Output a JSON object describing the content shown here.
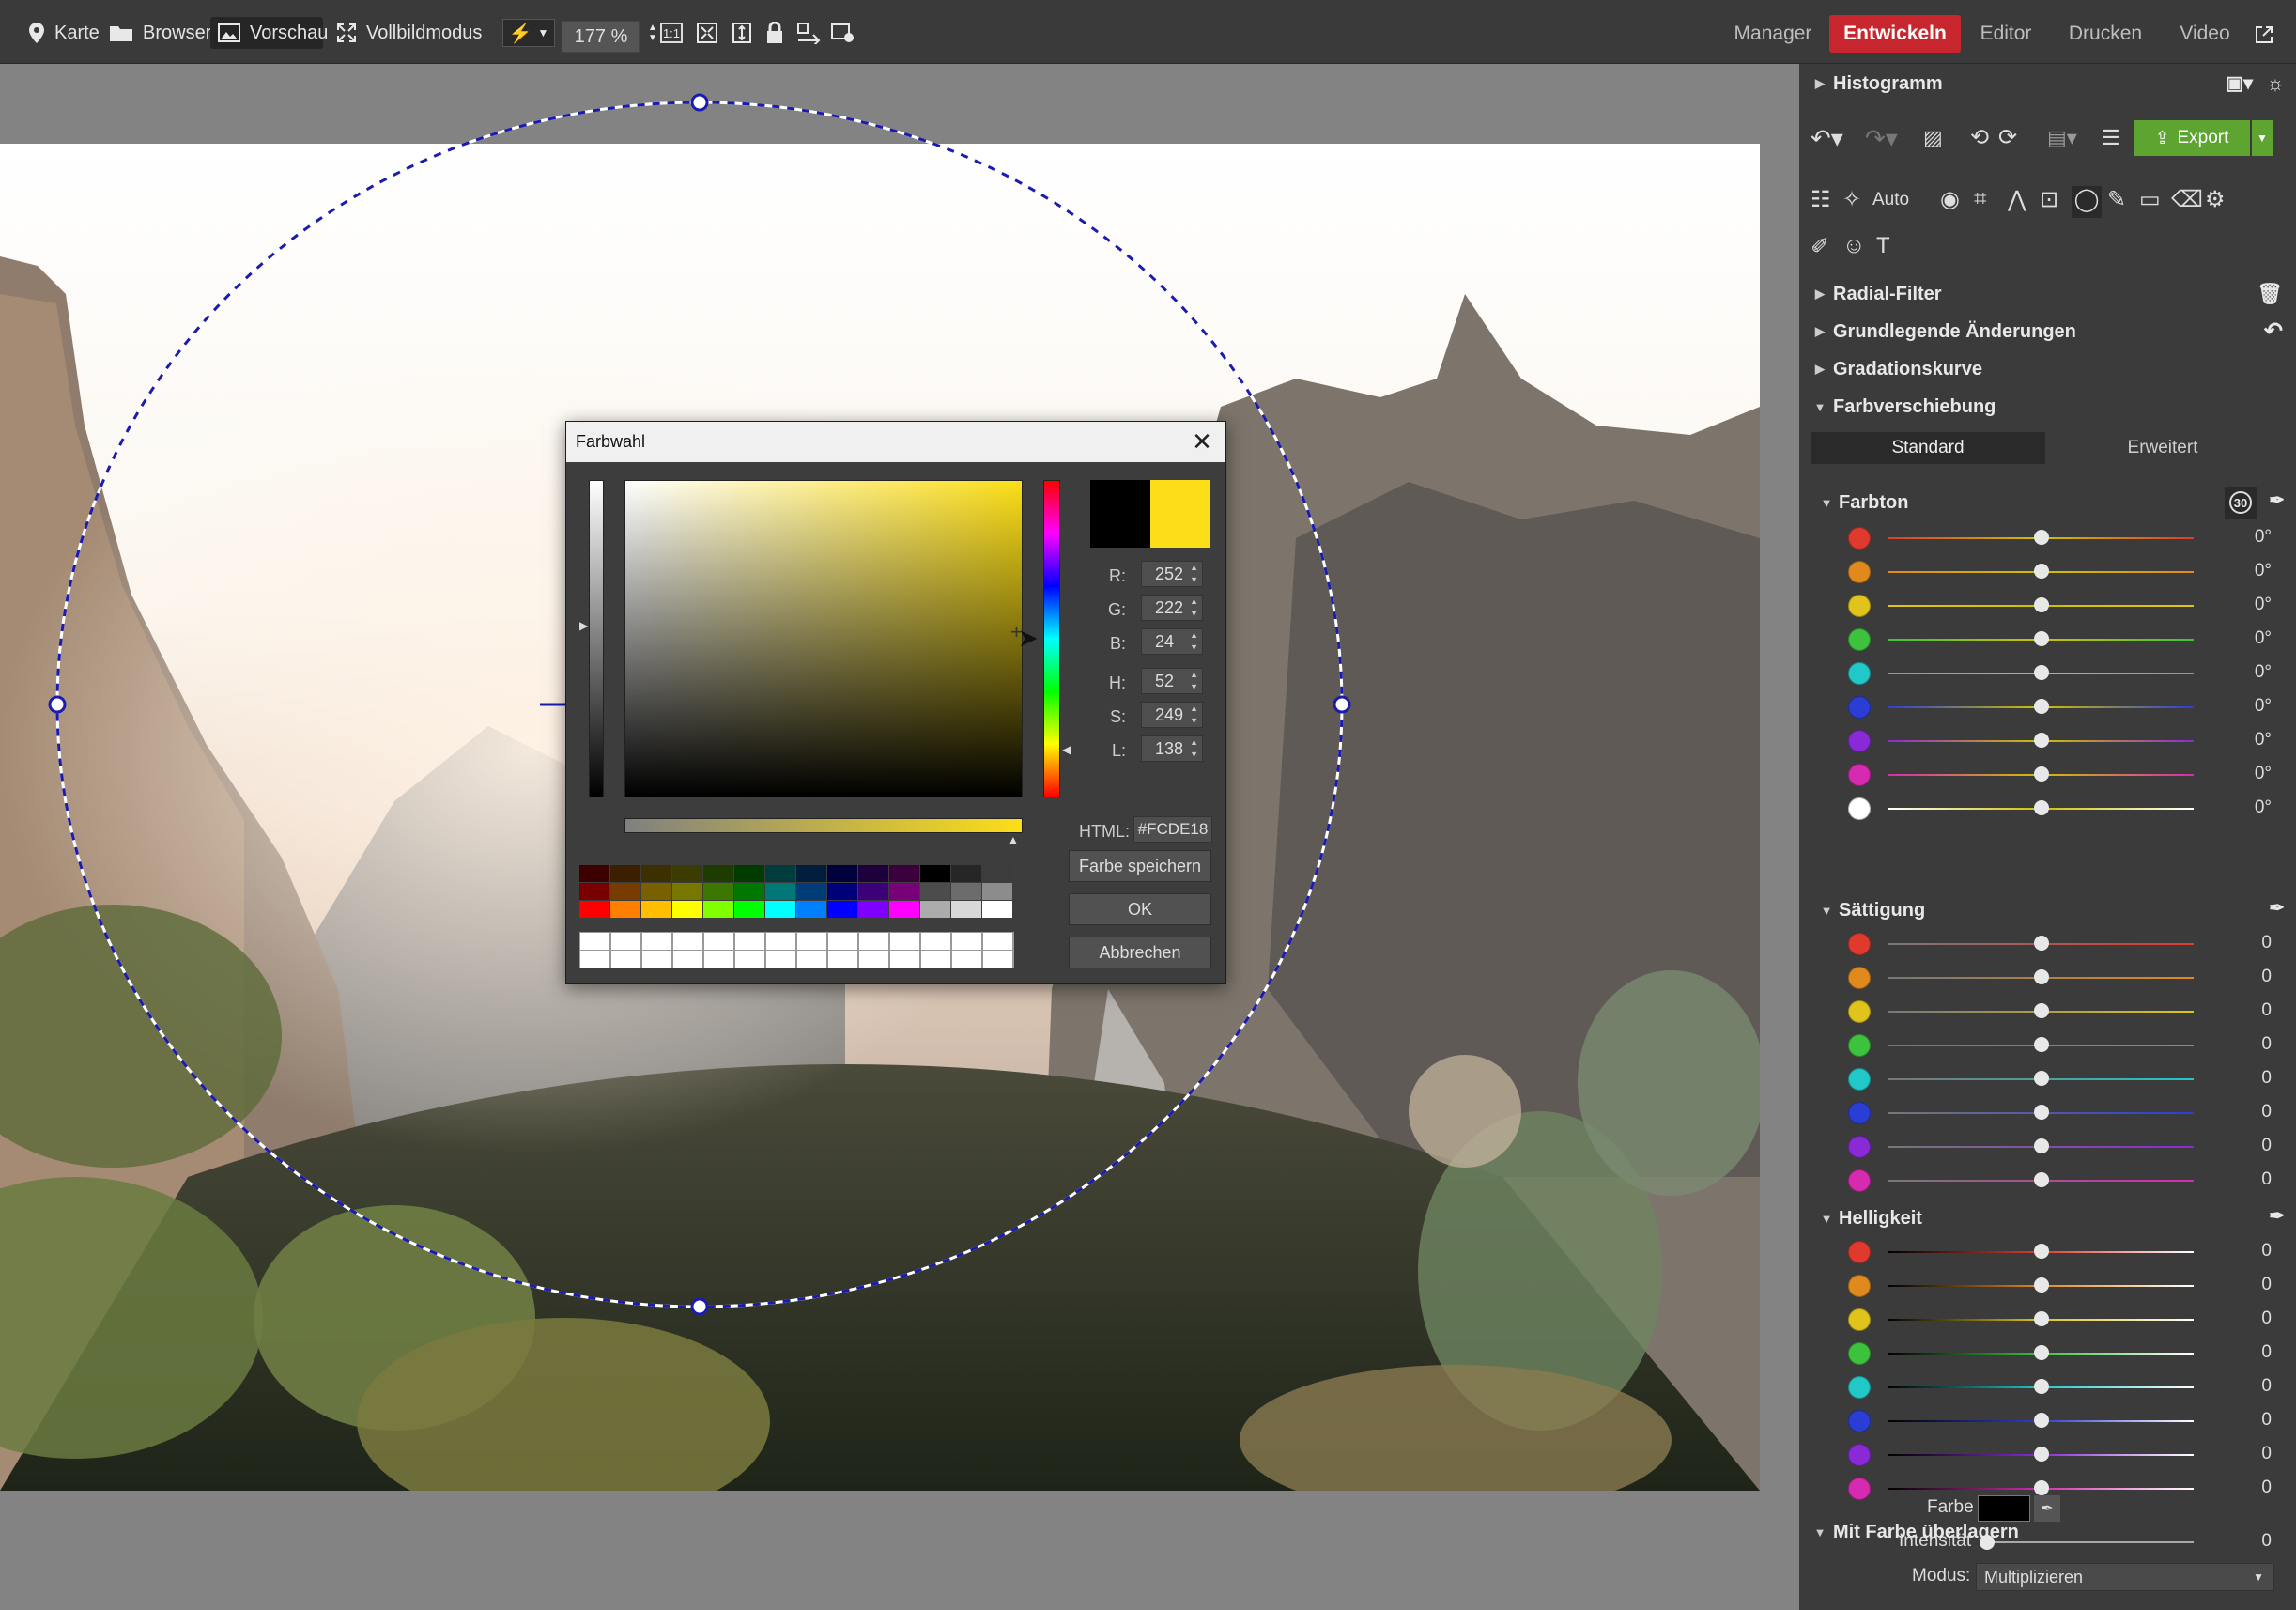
{
  "toolbar": {
    "karte": "Karte",
    "browser": "Browser",
    "vorschau": "Vorschau",
    "vollbild": "Vollbildmodus",
    "zoom": "177 %",
    "modes": [
      "Manager",
      "Entwickeln",
      "Editor",
      "Drucken",
      "Video"
    ],
    "active_mode": "Entwickeln"
  },
  "panel": {
    "histogram": "Histogramm",
    "export": "Export",
    "auto": "Auto",
    "sections": [
      "Radial-Filter",
      "Grundlegende Änderungen",
      "Gradationskurve",
      "Farbverschiebung"
    ],
    "tabs": [
      "Standard",
      "Erweitert"
    ],
    "farbton": {
      "title": "Farbton",
      "badge": "30",
      "colors": [
        "#e03a2e",
        "#e08a1e",
        "#e0c41c",
        "#3cc23c",
        "#20c8c8",
        "#2a3ed6",
        "#8a2ad6",
        "#d62ab0",
        "#ffffff"
      ],
      "values": [
        "0°",
        "0°",
        "0°",
        "0°",
        "0°",
        "0°",
        "0°",
        "0°",
        "0°"
      ]
    },
    "saettigung": {
      "title": "Sättigung",
      "colors": [
        "#e03a2e",
        "#e08a1e",
        "#e0c41c",
        "#3cc23c",
        "#20c8c8",
        "#2a3ed6",
        "#8a2ad6",
        "#d62ab0"
      ],
      "values": [
        "0",
        "0",
        "0",
        "0",
        "0",
        "0",
        "0",
        "0"
      ]
    },
    "helligkeit": {
      "title": "Helligkeit",
      "colors": [
        "#e03a2e",
        "#e08a1e",
        "#e0c41c",
        "#3cc23c",
        "#20c8c8",
        "#2a3ed6",
        "#8a2ad6",
        "#d62ab0"
      ],
      "values": [
        "0",
        "0",
        "0",
        "0",
        "0",
        "0",
        "0",
        "0"
      ]
    },
    "ueberlagern": {
      "title": "Mit Farbe überlagern",
      "farbe_label": "Farbe",
      "farbe_color": "#000000",
      "intensitaet_label": "Intensität",
      "intensitaet_value": "0",
      "modus_label": "Modus:",
      "modus_value": "Multiplizieren"
    }
  },
  "dialog": {
    "title": "Farbwahl",
    "r": "252",
    "g": "222",
    "b": "24",
    "h": "52",
    "s": "249",
    "l": "138",
    "html_label": "HTML:",
    "html_value": "#FCDE18",
    "save": "Farbe speichern",
    "ok": "OK",
    "cancel": "Abbrechen",
    "old_color": "#000000",
    "new_color": "#fcde18",
    "palette": [
      "#3c0000",
      "#3c1e00",
      "#3c3000",
      "#3c3c00",
      "#1e3c00",
      "#003c00",
      "#003c3c",
      "#001e3c",
      "#00003c",
      "#1e003c",
      "#3c003c",
      "#000000",
      "#262626",
      "#3c3c3c",
      "#780000",
      "#783c00",
      "#786000",
      "#787800",
      "#3c7800",
      "#007800",
      "#007878",
      "#003c78",
      "#000078",
      "#3c0078",
      "#780078",
      "#4c4c4c",
      "#6c6c6c",
      "#8c8c8c",
      "#ff0000",
      "#ff7f00",
      "#ffbf00",
      "#ffff00",
      "#7fff00",
      "#00ff00",
      "#00ffff",
      "#007fff",
      "#0000ff",
      "#7f00ff",
      "#ff00ff",
      "#acacac",
      "#d8d8d8",
      "#ffffff"
    ]
  }
}
